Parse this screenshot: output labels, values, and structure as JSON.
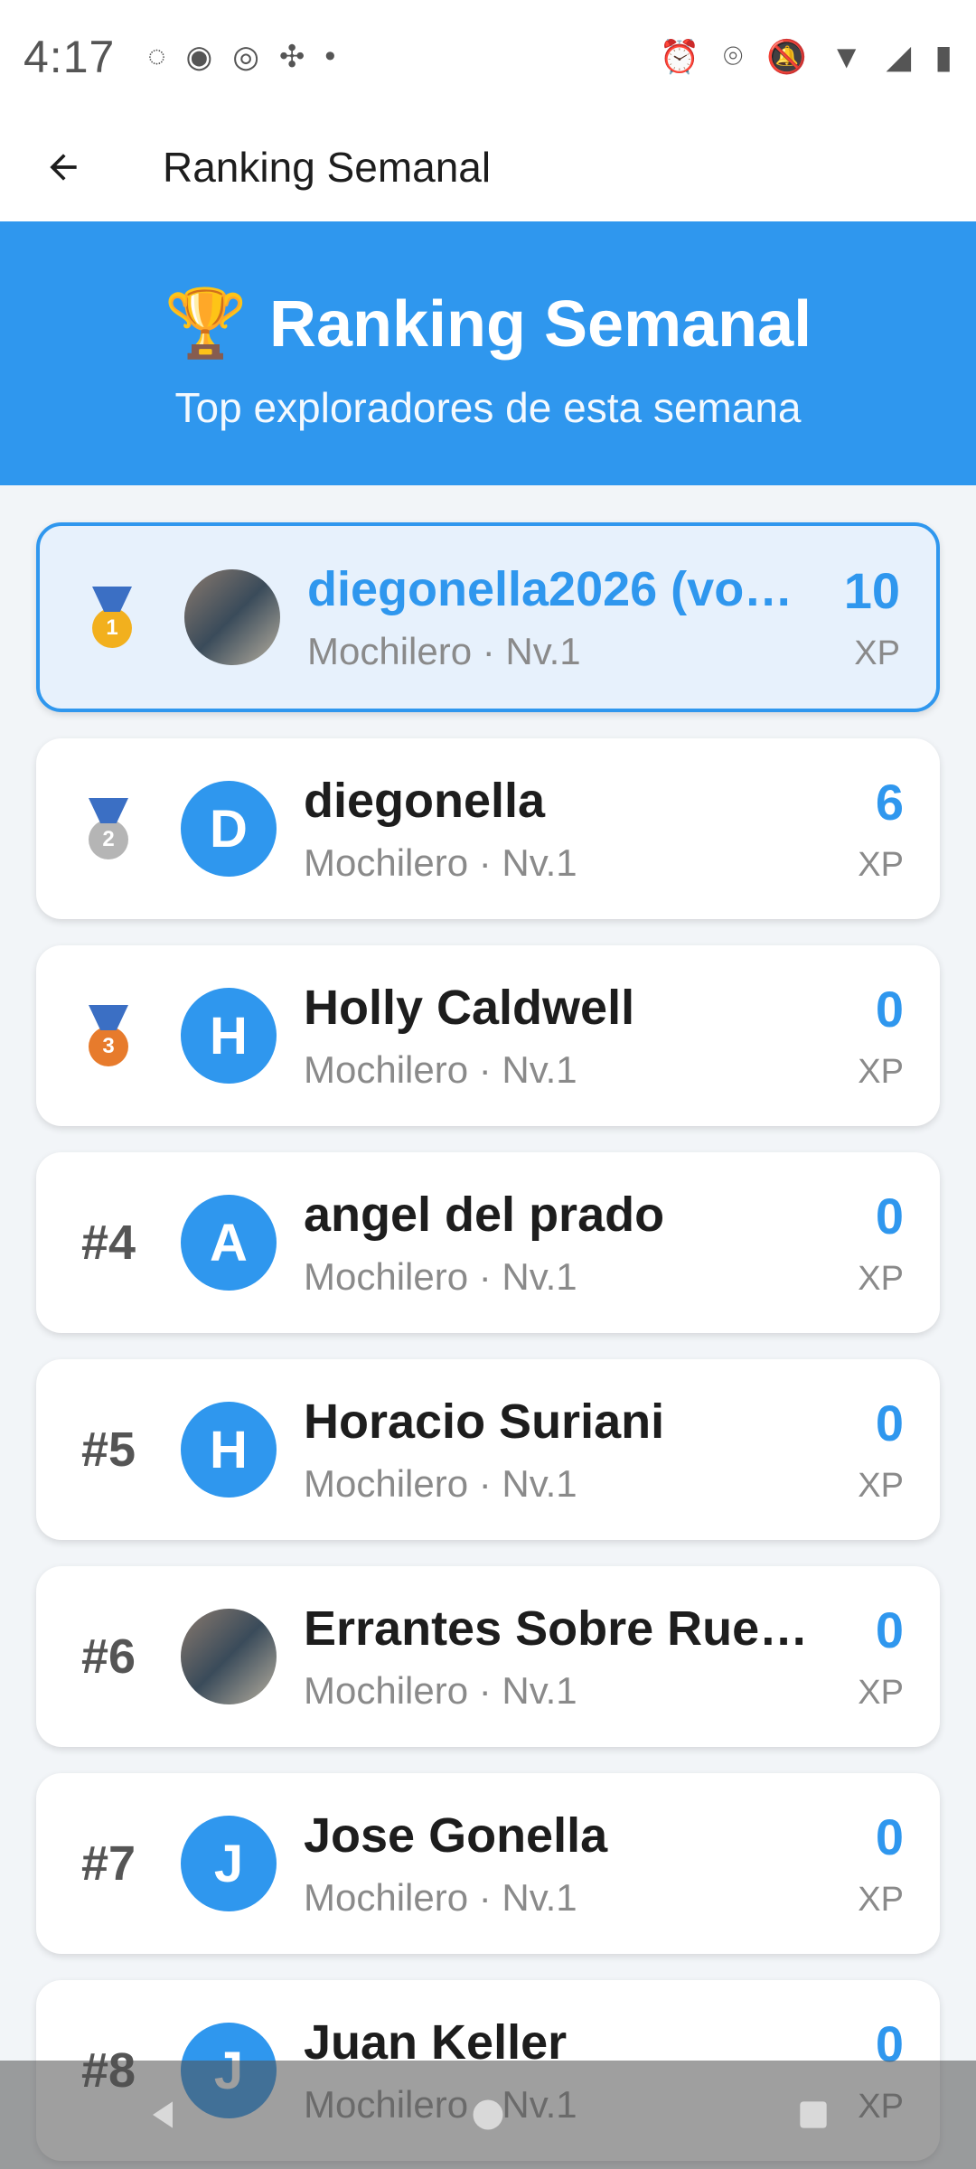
{
  "status": {
    "time": "4:17"
  },
  "appbar": {
    "title": "Ranking Semanal"
  },
  "hero": {
    "title": "Ranking Semanal",
    "subtitle": "Top exploradores de esta semana"
  },
  "rows": [
    {
      "rank": "",
      "medal": "gold",
      "avatar": "photo",
      "name": "diegonella2026 (vo…",
      "sub": "Mochilero · Nv.1",
      "xp": "10",
      "xp_label": "XP",
      "me": true
    },
    {
      "rank": "",
      "medal": "silver",
      "avatar": "D",
      "name": "diegonella",
      "sub": "Mochilero · Nv.1",
      "xp": "6",
      "xp_label": "XP"
    },
    {
      "rank": "",
      "medal": "bronze",
      "avatar": "H",
      "name": "Holly Caldwell",
      "sub": "Mochilero · Nv.1",
      "xp": "0",
      "xp_label": "XP"
    },
    {
      "rank": "#4",
      "avatar": "A",
      "name": "angel del prado",
      "sub": "Mochilero · Nv.1",
      "xp": "0",
      "xp_label": "XP"
    },
    {
      "rank": "#5",
      "avatar": "H",
      "name": "Horacio Suriani",
      "sub": "Mochilero · Nv.1",
      "xp": "0",
      "xp_label": "XP"
    },
    {
      "rank": "#6",
      "avatar": "photo",
      "name": "Errantes Sobre Rue…",
      "sub": "Mochilero · Nv.1",
      "xp": "0",
      "xp_label": "XP"
    },
    {
      "rank": "#7",
      "avatar": "J",
      "name": "Jose Gonella",
      "sub": "Mochilero · Nv.1",
      "xp": "0",
      "xp_label": "XP"
    },
    {
      "rank": "#8",
      "avatar": "J",
      "name": "Juan Keller",
      "sub": "Mochilero · Nv.1",
      "xp": "0",
      "xp_label": "XP"
    }
  ],
  "colors": {
    "primary": "#2f97ee",
    "background": "#f2f5f8"
  },
  "icons": {
    "back": "arrow-left-icon",
    "trophy": "trophy-icon"
  }
}
